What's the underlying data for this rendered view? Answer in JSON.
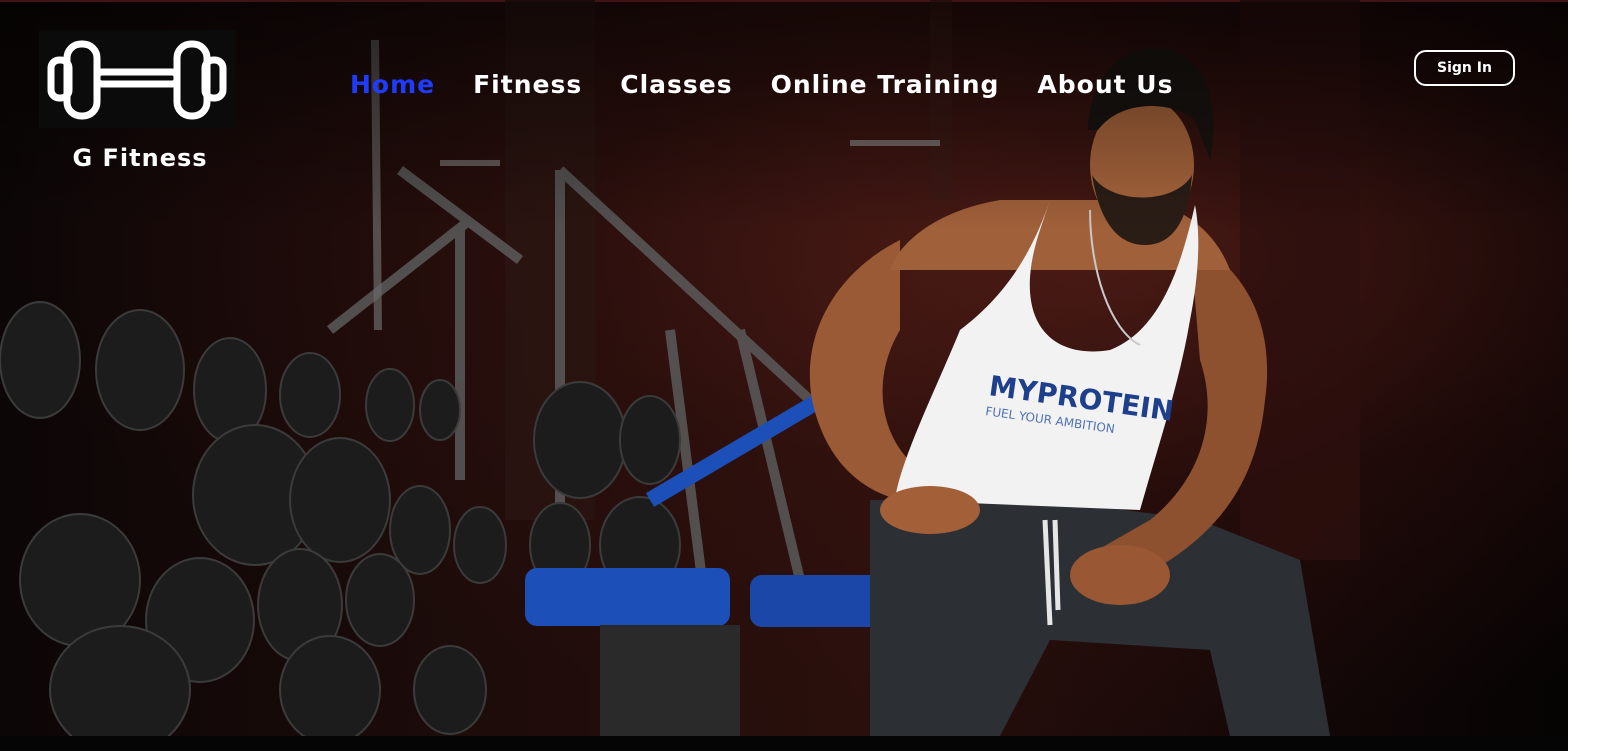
{
  "brand": {
    "name": "G Fitness",
    "logo_icon": "dumbbell-icon"
  },
  "nav": {
    "items": [
      {
        "label": "Home",
        "active": true
      },
      {
        "label": "Fitness",
        "active": false
      },
      {
        "label": "Classes",
        "active": false
      },
      {
        "label": "Online Training",
        "active": false
      },
      {
        "label": "About Us",
        "active": false
      }
    ]
  },
  "header": {
    "sign_in_label": "Sign In"
  },
  "hero": {
    "shirt_text": "MYPROTEIN",
    "shirt_tagline": "FUEL YOUR AMBITION"
  },
  "colors": {
    "active_nav": "#1f3bff",
    "text": "#ffffff",
    "background": "#000000",
    "bench_blue": "#1d4fb8"
  }
}
